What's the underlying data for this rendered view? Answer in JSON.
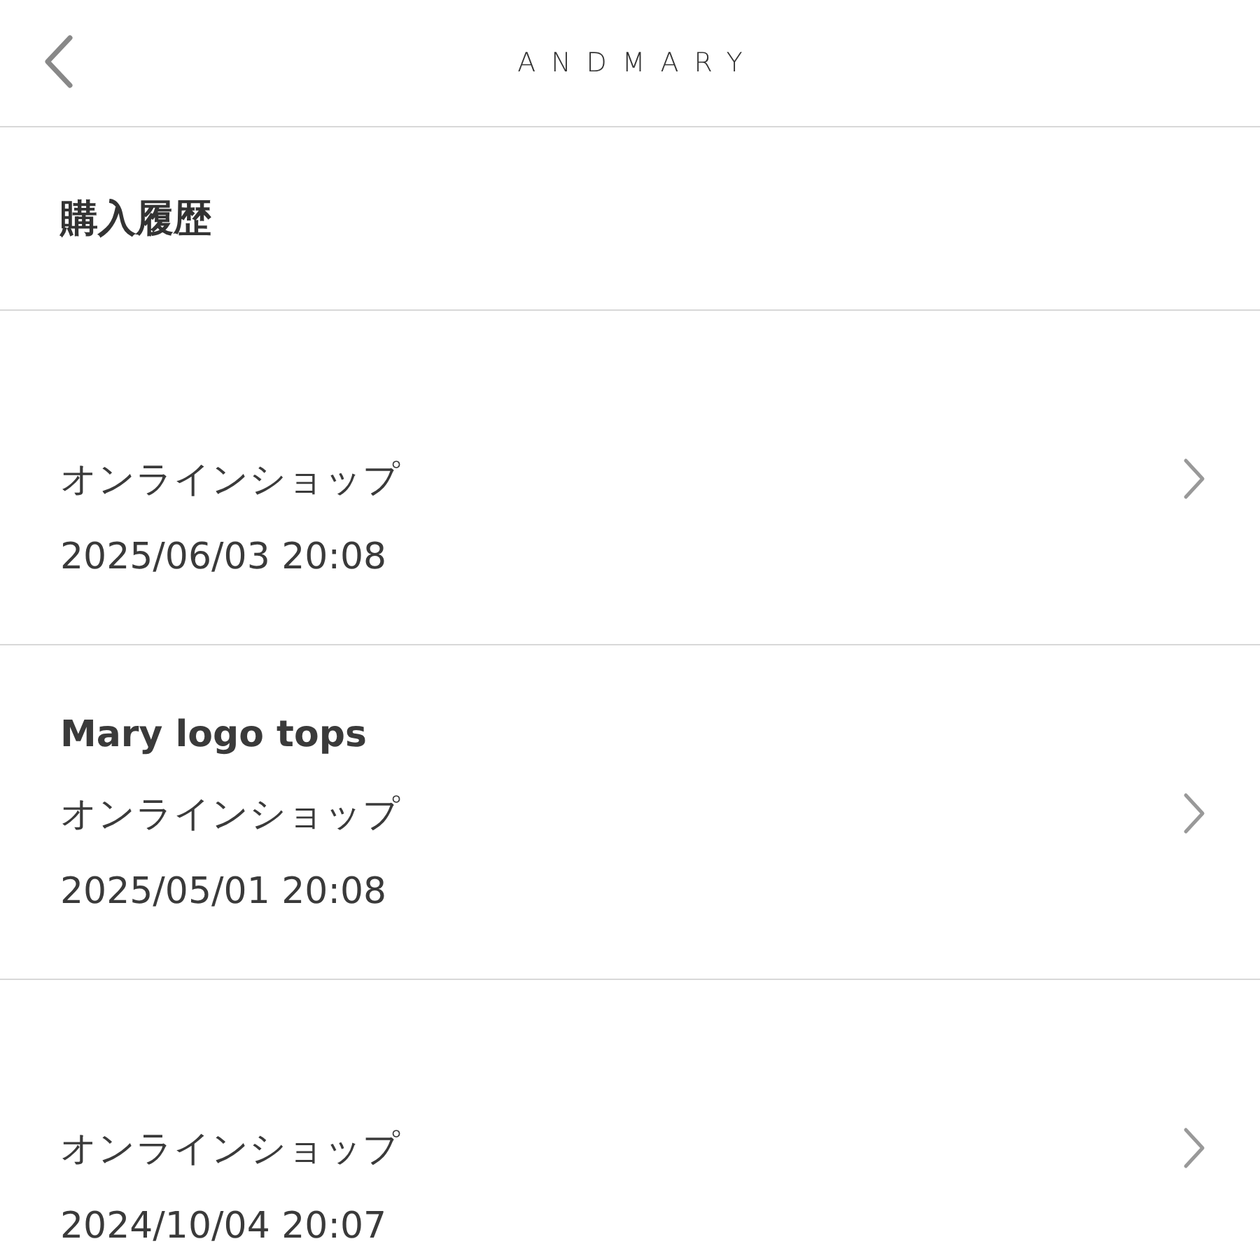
{
  "header": {
    "logo": "ANDMARY"
  },
  "page_title": "購入履歴",
  "orders": [
    {
      "shop": "オンラインショップ",
      "date": "2025/06/03 20:08"
    },
    {
      "title": "Mary logo tops",
      "shop": "オンラインショップ",
      "date": "2025/05/01 20:08"
    },
    {
      "shop": "オンラインショップ",
      "date": "2024/10/04 20:07"
    }
  ]
}
